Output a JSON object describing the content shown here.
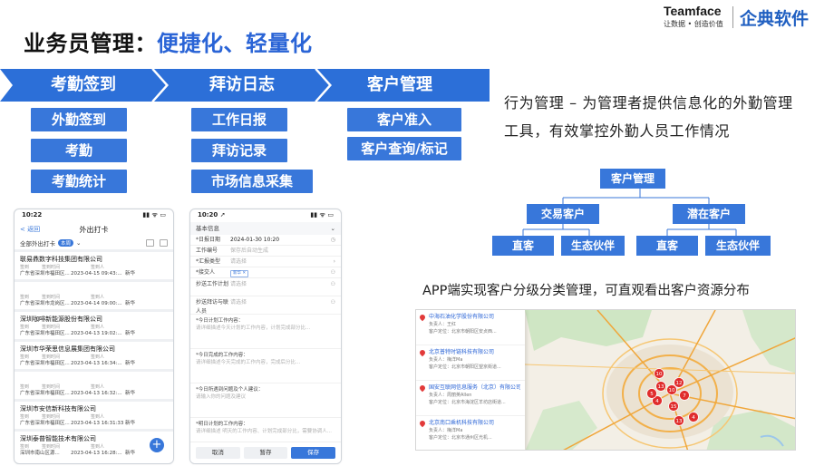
{
  "title": {
    "prefix": "业务员管理：",
    "highlight": "便捷化、轻量化"
  },
  "logo": {
    "brand": "Teamface",
    "slogan": "让数据 • 创造价值",
    "cn": "企典软件"
  },
  "features": [
    {
      "label": "考勤签到",
      "items": [
        "外勤签到",
        "考勤",
        "考勤统计"
      ]
    },
    {
      "label": "拜访日志",
      "items": [
        "工作日报",
        "拜访记录",
        "市场信息采集"
      ]
    },
    {
      "label": "客户管理",
      "items": [
        "客户准入",
        "客户查询/标记"
      ]
    }
  ],
  "description": "行为管理 – 为管理者提供信息化的外勤管理工具，有效掌控外勤人员工作情况",
  "tree": {
    "root": "客户管理",
    "left": "交易客户",
    "right": "潜在客户",
    "leaves": [
      "直客",
      "生态伙伴",
      "直客",
      "生态伙伴"
    ]
  },
  "app_caption": "APP端实现客户分级分类管理，可直观看出客户资源分布",
  "phone1": {
    "time": "10:22",
    "status_icons": "▮▮ ᯤ ▭",
    "back": "< 返回",
    "title": "外出打卡",
    "filter": "全部外出打卡",
    "filter_badge": "本周",
    "cols": [
      "签到",
      "签到时间",
      "签到人"
    ],
    "records": [
      {
        "name": "联易鼎数字科技集团有限公司",
        "addr": "广东省深圳市福田区...",
        "time": "2023-04-15 09:43:...",
        "user": "新华"
      },
      {
        "name": "",
        "addr": "广东省深圳市龙岗区...",
        "time": "2023-04-14 09:00:...",
        "user": "新华"
      },
      {
        "name": "深圳咖啡新能源股份有限公司",
        "addr": "广东省深圳市福田区...",
        "time": "2023-04-13 19:02:...",
        "user": "新华"
      },
      {
        "name": "深圳市华荣思信息展集团有限公司",
        "addr": "广东省深圳市福田区...",
        "time": "2023-04-13 16:34:...",
        "user": "新华"
      },
      {
        "name": "",
        "addr": "广东省深圳市福田区...",
        "time": "2023-04-13 16:32:...",
        "user": "新华"
      },
      {
        "name": "深圳市安信新科技有限公司",
        "addr": "广东省深圳市福田区...",
        "time": "2023-04-13 16:31:33",
        "user": "新华"
      },
      {
        "name": "深圳泰普智能技术有限公司",
        "addr": "深圳市南山区源...",
        "time": "2023-04-13 16:28:...",
        "user": "新华"
      }
    ],
    "fab": "+"
  },
  "phone2": {
    "time": "10:20 ➚",
    "status_icons": "▮▮ ᯤ ▭",
    "section": "基本信息",
    "fields": [
      {
        "label": "*日报日期",
        "value": "2024-01-30 10:20",
        "placeholder": false,
        "icon": "◷"
      },
      {
        "label": "工作编号",
        "value": "保存后自动生成",
        "placeholder": true,
        "icon": ""
      },
      {
        "label": "*汇报类型",
        "value": "请选择",
        "placeholder": true,
        "icon": "›"
      },
      {
        "label": "*接交人",
        "value": "新华 ✕",
        "placeholder": false,
        "tag": true,
        "icon": "⚇"
      }
    ],
    "tall_fields": [
      {
        "label": "抄送工作计划",
        "value": "请选择",
        "icon": "⚇"
      },
      {
        "label": "抄送拜访与联人员",
        "value": "请选择",
        "icon": "⚇"
      }
    ],
    "blocks": [
      {
        "label": "*今日计划工作内容：",
        "placeholder": "请详细描述今天计划的工作内容，计划完成部分比..."
      },
      {
        "label": "*今日完成的工作内容：",
        "placeholder": "请详细描述今天完成的工作内容，完成后分比..."
      },
      {
        "label": "*今日所遇到问题及个人建议：",
        "placeholder": "请输入你的问题及建议"
      },
      {
        "label": "*明日计划的工作内容：",
        "placeholder": "请详细描述 明天的工作内容、计划完成部分比，需要协调人..."
      }
    ],
    "actions": [
      "取消",
      "暂存",
      "保存"
    ]
  },
  "map": {
    "companies": [
      {
        "name": "中海石油化学股份有限公司",
        "owner": "负责人：王红",
        "addr": "客户定位：北京市朝阳区安贞西..."
      },
      {
        "name": "北京普特时链科技有限公司",
        "owner": "负责人：梅洋Ma",
        "addr": "客户定位：北京市朝阳区望京街道..."
      },
      {
        "name": "国安互联网信息服务（北京）有限公司",
        "owner": "负责人：周丽英Allen",
        "addr": "客户定位：北京市海淀区羊坊店街道..."
      },
      {
        "name": "北京南口乘机科技有限公司",
        "owner": "负责人：梅洋Ma",
        "addr": "客户定位：北京市通州区光机..."
      }
    ],
    "markers": [
      "10",
      "13",
      "10",
      "12",
      "7",
      "4",
      "15",
      "13",
      "4",
      "5"
    ]
  }
}
